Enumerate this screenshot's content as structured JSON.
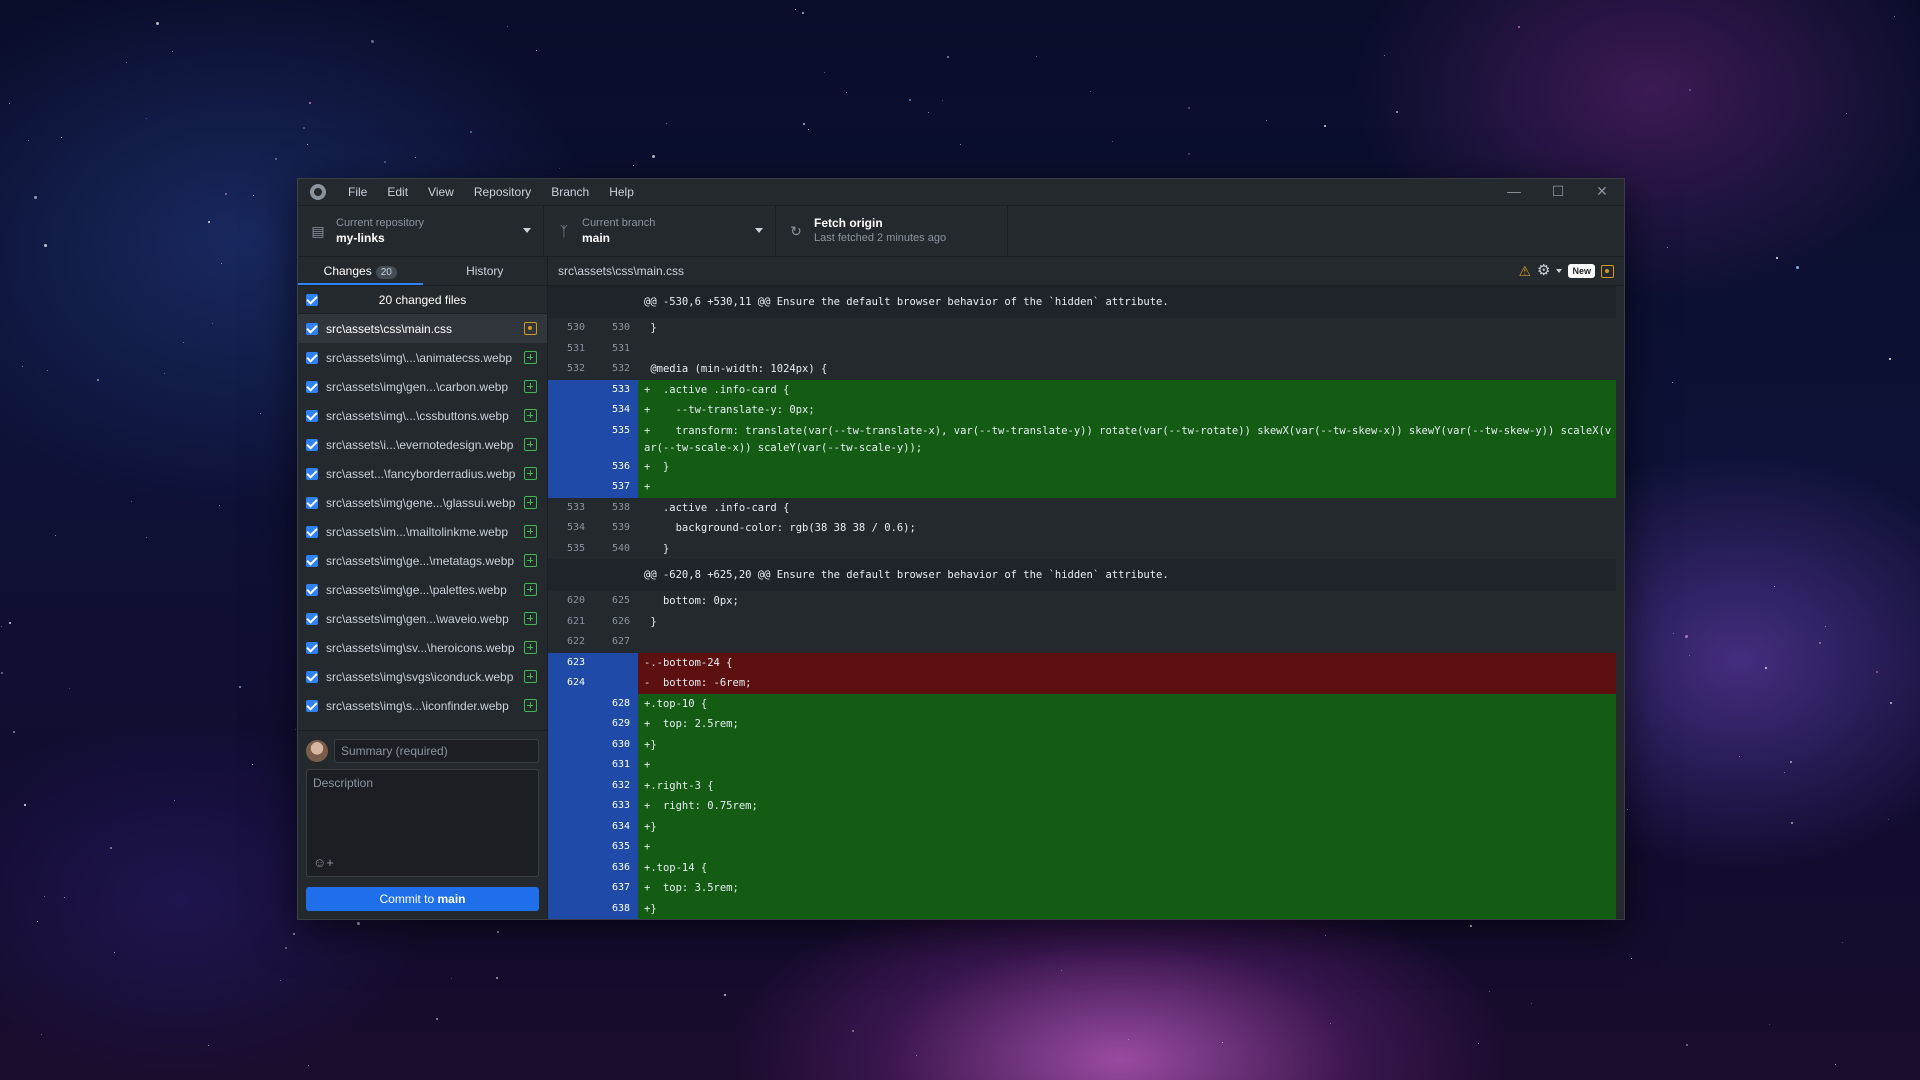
{
  "app": {
    "menu": [
      "File",
      "Edit",
      "View",
      "Repository",
      "Branch",
      "Help"
    ],
    "window_controls": [
      "minimize",
      "maximize",
      "close"
    ]
  },
  "toolbar": {
    "repo_label": "Current repository",
    "repo_value": "my-links",
    "branch_label": "Current branch",
    "branch_value": "main",
    "fetch_label": "Fetch origin",
    "fetch_sub": "Last fetched 2 minutes ago"
  },
  "sidebar": {
    "tab_changes": "Changes",
    "tab_changes_count": "20",
    "tab_history": "History",
    "changed_files_label": "20 changed files",
    "files": [
      {
        "path": "src\\assets\\css\\main.css",
        "status": "modified",
        "selected": true
      },
      {
        "path": "src\\assets\\img\\...\\animatecss.webp",
        "status": "added"
      },
      {
        "path": "src\\assets\\img\\gen...\\carbon.webp",
        "status": "added"
      },
      {
        "path": "src\\assets\\img\\...\\cssbuttons.webp",
        "status": "added"
      },
      {
        "path": "src\\assets\\i...\\evernotedesign.webp",
        "status": "added"
      },
      {
        "path": "src\\asset...\\fancyborderradius.webp",
        "status": "added"
      },
      {
        "path": "src\\assets\\img\\gene...\\glassui.webp",
        "status": "added"
      },
      {
        "path": "src\\assets\\im...\\mailtolinkme.webp",
        "status": "added"
      },
      {
        "path": "src\\assets\\img\\ge...\\metatags.webp",
        "status": "added"
      },
      {
        "path": "src\\assets\\img\\ge...\\palettes.webp",
        "status": "added"
      },
      {
        "path": "src\\assets\\img\\gen...\\waveio.webp",
        "status": "added"
      },
      {
        "path": "src\\assets\\img\\sv...\\heroicons.webp",
        "status": "added"
      },
      {
        "path": "src\\assets\\img\\svgs\\iconduck.webp",
        "status": "added"
      },
      {
        "path": "src\\assets\\img\\s...\\iconfinder.webp",
        "status": "added"
      }
    ],
    "summary_placeholder": "Summary (required)",
    "description_placeholder": "Description",
    "commit_prefix": "Commit to ",
    "commit_branch": "main"
  },
  "diff": {
    "file_path": "src\\assets\\css\\main.css",
    "new_badge": "New",
    "lines": [
      {
        "type": "hunk",
        "old": "",
        "new": "",
        "text": "@@ -530,6 +530,11 @@ Ensure the default browser behavior of the `hidden` attribute."
      },
      {
        "type": "ctx",
        "old": "530",
        "new": "530",
        "text": " }"
      },
      {
        "type": "ctx",
        "old": "531",
        "new": "531",
        "text": ""
      },
      {
        "type": "ctx",
        "old": "532",
        "new": "532",
        "text": " @media (min-width: 1024px) {"
      },
      {
        "type": "add",
        "old": "",
        "new": "533",
        "text": "+  .active .info-card {"
      },
      {
        "type": "add",
        "old": "",
        "new": "534",
        "text": "+    --tw-translate-y: 0px;"
      },
      {
        "type": "add wrap",
        "old": "",
        "new": "535",
        "text": "+    transform: translate(var(--tw-translate-x), var(--tw-translate-y)) rotate(var(--tw-rotate)) skewX(var(--tw-skew-x)) skewY(var(--tw-skew-y)) scaleX(var(--tw-scale-x)) scaleY(var(--tw-scale-y));"
      },
      {
        "type": "add",
        "old": "",
        "new": "536",
        "text": "+  }"
      },
      {
        "type": "add",
        "old": "",
        "new": "537",
        "text": "+"
      },
      {
        "type": "ctx",
        "old": "533",
        "new": "538",
        "text": "   .active .info-card {"
      },
      {
        "type": "ctx",
        "old": "534",
        "new": "539",
        "text": "     background-color: rgb(38 38 38 / 0.6);"
      },
      {
        "type": "ctx",
        "old": "535",
        "new": "540",
        "text": "   }"
      },
      {
        "type": "hunk",
        "old": "",
        "new": "",
        "text": "@@ -620,8 +625,20 @@ Ensure the default browser behavior of the `hidden` attribute."
      },
      {
        "type": "ctx",
        "old": "620",
        "new": "625",
        "text": "   bottom: 0px;"
      },
      {
        "type": "ctx",
        "old": "621",
        "new": "626",
        "text": " }"
      },
      {
        "type": "ctx",
        "old": "622",
        "new": "627",
        "text": ""
      },
      {
        "type": "del",
        "old": "623",
        "new": "",
        "text": "-.-bottom-24 {"
      },
      {
        "type": "del",
        "old": "624",
        "new": "",
        "text": "-  bottom: -6rem;"
      },
      {
        "type": "add",
        "old": "",
        "new": "628",
        "text": "+.top-10 {"
      },
      {
        "type": "add",
        "old": "",
        "new": "629",
        "text": "+  top: 2.5rem;"
      },
      {
        "type": "add",
        "old": "",
        "new": "630",
        "text": "+}"
      },
      {
        "type": "add",
        "old": "",
        "new": "631",
        "text": "+"
      },
      {
        "type": "add",
        "old": "",
        "new": "632",
        "text": "+.right-3 {"
      },
      {
        "type": "add",
        "old": "",
        "new": "633",
        "text": "+  right: 0.75rem;"
      },
      {
        "type": "add",
        "old": "",
        "new": "634",
        "text": "+}"
      },
      {
        "type": "add",
        "old": "",
        "new": "635",
        "text": "+"
      },
      {
        "type": "add",
        "old": "",
        "new": "636",
        "text": "+.top-14 {"
      },
      {
        "type": "add",
        "old": "",
        "new": "637",
        "text": "+  top: 3.5rem;"
      },
      {
        "type": "add",
        "old": "",
        "new": "638",
        "text": "+}"
      }
    ]
  },
  "colors": {
    "accent": "#1f6feb",
    "added_bg": "#145c14",
    "removed_bg": "#5c1010",
    "gutter_changed": "#1f4aa8"
  }
}
